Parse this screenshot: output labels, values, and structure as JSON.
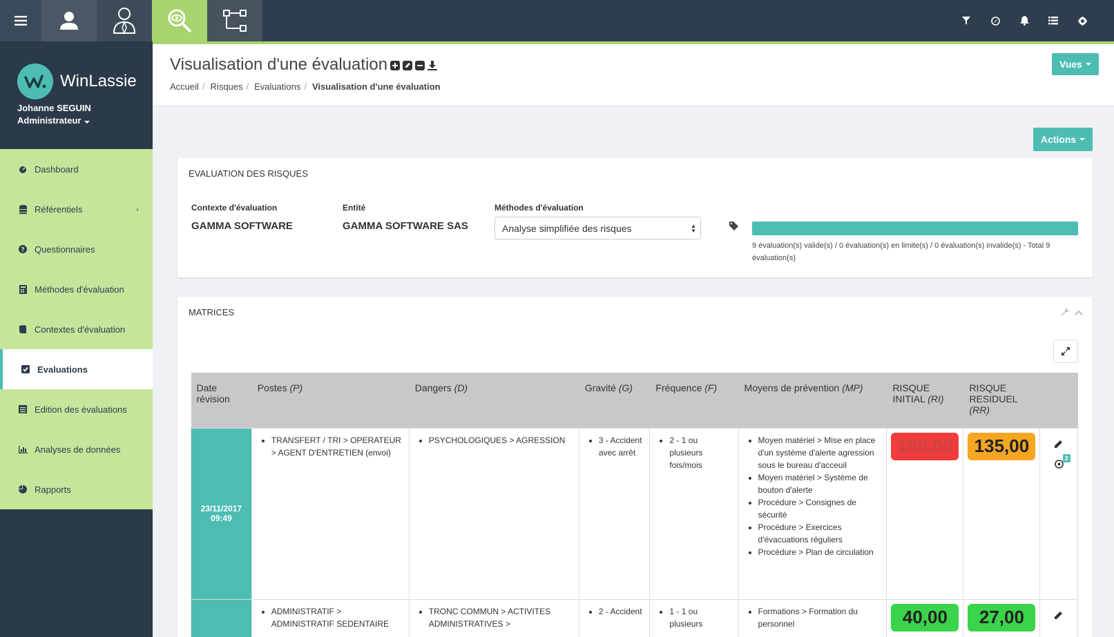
{
  "topbar": {
    "icons_left": [
      "menu-icon",
      "user-icon",
      "user-tie-icon",
      "eye-search-icon",
      "flowchart-icon"
    ],
    "icons_right": [
      "filter-icon",
      "compass-icon",
      "bell-icon",
      "list-icon",
      "gear-icon"
    ]
  },
  "sidebar": {
    "brand": "WinLassie",
    "user_name": "Johanne SEGUIN",
    "user_role": "Administrateur",
    "items": [
      {
        "label": "Dashboard",
        "icon": "dashboard-icon"
      },
      {
        "label": "Référentiels",
        "icon": "database-icon"
      },
      {
        "label": "Questionnaires",
        "icon": "question-icon"
      },
      {
        "label": "Méthodes d'évaluation",
        "icon": "calculator-icon"
      },
      {
        "label": "Contextes d'évaluation",
        "icon": "book-icon"
      },
      {
        "label": "Evaluations",
        "icon": "check-square-icon"
      },
      {
        "label": "Edition des évaluations",
        "icon": "list-alt-icon"
      },
      {
        "label": "Analyses de données",
        "icon": "bar-chart-icon"
      },
      {
        "label": "Rapports",
        "icon": "pie-chart-icon"
      }
    ]
  },
  "header": {
    "title": "Visualisation d'une évaluation",
    "breadcrumb": [
      "Accueil",
      "Risques",
      "Evaluations",
      "Visualisation d'une évaluation"
    ],
    "vues_label": "Vues",
    "actions_label": "Actions"
  },
  "evaluation_panel": {
    "title": "EVALUATION DES RISQUES",
    "context_label": "Contexte d'évaluation",
    "context_value": "GAMMA SOFTWARE",
    "entity_label": "Entité",
    "entity_value": "GAMMA SOFTWARE SAS",
    "method_label": "Méthodes d'évaluation",
    "method_value": "Analyse simplifiée des risques",
    "progress_fraction": 1.0,
    "progress_text": "9 évaluation(s) valide(s) / 0 évaluation(s) en limite(s) / 0 évaluation(s) invalide(s) - Total 9 évaluation(s)"
  },
  "matrices_panel": {
    "title": "MATRICES",
    "columns": [
      {
        "main": "Date révision",
        "suffix": ""
      },
      {
        "main": "Postes ",
        "suffix": "(P)"
      },
      {
        "main": "Dangers ",
        "suffix": "(D)"
      },
      {
        "main": "Gravité ",
        "suffix": "(G)"
      },
      {
        "main": "Fréquence ",
        "suffix": "(F)"
      },
      {
        "main": "Moyens de prévention ",
        "suffix": "(MP)"
      },
      {
        "main": "RISQUE INITIAL ",
        "suffix": "(RI)"
      },
      {
        "main": "RISQUE RESIDUEL ",
        "suffix": "(RR)"
      }
    ],
    "rows": [
      {
        "date": "23/11/2017",
        "time": "09:49",
        "postes": [
          "TRANSFERT / TRI > OPERATEUR > AGENT D'ENTRETIEN (envoi)"
        ],
        "dangers": [
          "PSYCHOLOGIQUES > AGRESSION"
        ],
        "gravite": [
          "3 - Accident avec arrêt"
        ],
        "frequence": [
          "2 - 1 ou plusieurs fois/mois"
        ],
        "moyens": [
          "Moyen matériel > Mise en place d'un système d'alerte agression sous le bureau d'acceuil",
          "Moyen matériel > Système de bouton d'alerte",
          "Procédure > Consignes de sécurité",
          "Procédure > Exercices d'évacuations réguliers",
          "Procédure > Plan de circulation"
        ],
        "risque_initial": "160,00",
        "risque_initial_color": "#f03c3c",
        "risque_residuel": "135,00",
        "risque_residuel_color": "#f5a623",
        "badge_count": "2"
      },
      {
        "date": "",
        "time": "",
        "postes": [
          "ADMINISTRATIF > ADMINISTRATIF SEDENTAIRE"
        ],
        "dangers": [
          "TRONC COMMUN > ACTIVITES ADMINISTRATIVES >"
        ],
        "gravite": [
          "2 - Accident"
        ],
        "frequence": [
          "1 - 1 ou plusieurs"
        ],
        "moyens": [
          "Formations > Formation du personnel"
        ],
        "risque_initial": "40,00",
        "risque_initial_color": "#3ad44a",
        "risque_residuel": "27,00",
        "risque_residuel_color": "#3ad44a",
        "badge_count": ""
      }
    ]
  }
}
